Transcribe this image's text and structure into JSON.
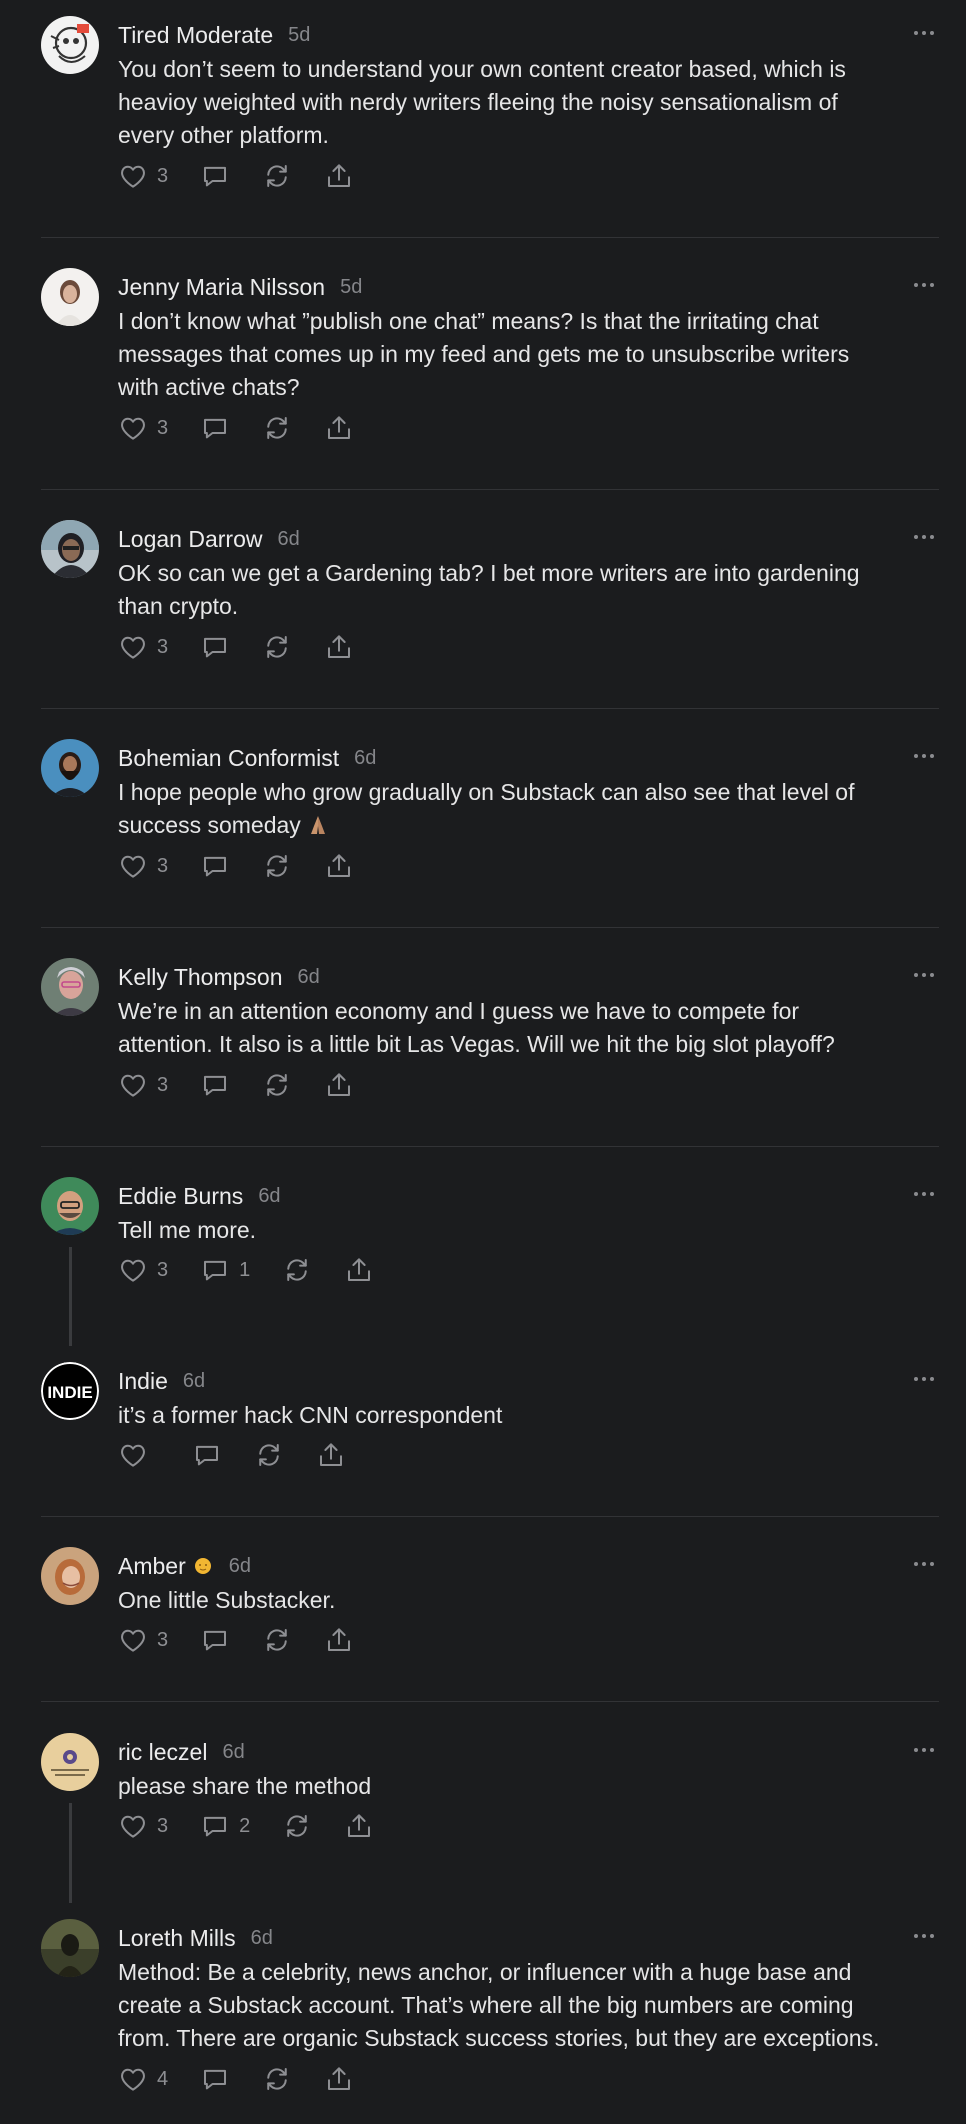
{
  "comments": [
    {
      "name": "Tired Moderate",
      "time": "5d",
      "lines": [
        "You don’t seem to understand your own content creator based, which is",
        "heavioy weighted with nerdy writers fleeing the noisy sensationalism of",
        "every other platform."
      ],
      "likes": "3",
      "replies": ""
    },
    {
      "name": "Jenny Maria Nilsson",
      "time": "5d",
      "lines": [
        "I don’t know what ”publish one chat” means? Is that the irritating chat",
        "messages that comes up in my feed and gets me to unsubscribe writers",
        "with active chats?"
      ],
      "likes": "3",
      "replies": ""
    },
    {
      "name": "Logan Darrow",
      "time": "6d",
      "lines": [
        "OK so can we get a Gardening tab? I bet more writers are into gardening",
        "than crypto."
      ],
      "likes": "3",
      "replies": ""
    },
    {
      "name": "Bohemian Conformist",
      "time": "6d",
      "lines": [
        "I hope people who grow gradually on Substack can also see that level of",
        "success someday"
      ],
      "likes": "3",
      "replies": ""
    },
    {
      "name": "Kelly Thompson",
      "time": "6d",
      "lines": [
        "We’re in an attention economy and I guess we have to compete for",
        "attention. It also is a little bit Las Vegas. Will we hit the big slot playoff?"
      ],
      "likes": "3",
      "replies": ""
    },
    {
      "name": "Eddie Burns",
      "time": "6d",
      "lines": [
        "Tell me more."
      ],
      "likes": "3",
      "replies": "1"
    },
    {
      "name": "Indie",
      "time": "6d",
      "lines": [
        "it’s a former hack CNN correspondent"
      ],
      "likes": "",
      "replies": "",
      "avatar_text": "INDIE"
    },
    {
      "name": "Amber",
      "time": "6d",
      "lines": [
        "One little Substacker."
      ],
      "likes": "3",
      "replies": ""
    },
    {
      "name": "ric leczel",
      "time": "6d",
      "lines": [
        "please share the method"
      ],
      "likes": "3",
      "replies": "2"
    },
    {
      "name": "Loreth Mills",
      "time": "6d",
      "lines": [
        "Method: Be a celebrity, news anchor, or influencer with a huge base and",
        "create a Substack account. That’s where all the big numbers are coming",
        "from. There are organic Substack success stories, but they are exceptions."
      ],
      "likes": "4",
      "replies": ""
    }
  ],
  "colors": {
    "background": "#1b1c1e",
    "text": "#e6e6e7",
    "muted": "#85868a",
    "divider": "#323336"
  },
  "icons": [
    "heart-icon",
    "comment-icon",
    "restack-icon",
    "share-icon",
    "more-icon"
  ]
}
